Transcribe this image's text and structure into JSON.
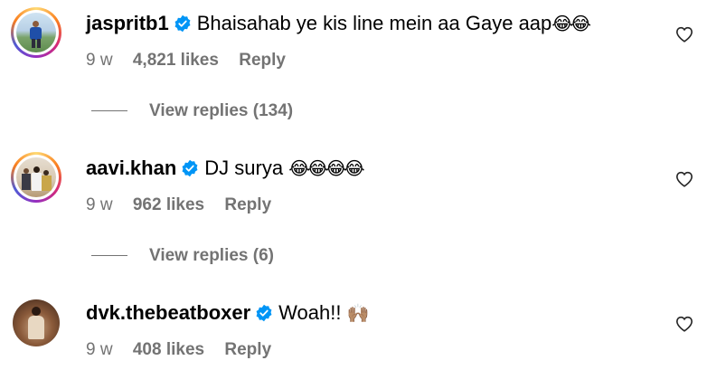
{
  "comments": [
    {
      "username": "jaspritb1",
      "text": "Bhaisahab ye kis line mein aa Gaye aap",
      "emoji": "😂😂",
      "time": "9 w",
      "likes": "4,821 likes",
      "reply_label": "Reply",
      "view_replies": "View replies (134)"
    },
    {
      "username": "aavi.khan",
      "text": "DJ surya",
      "emoji": "😂😂😂😂",
      "time": "9 w",
      "likes": "962 likes",
      "reply_label": "Reply",
      "view_replies": "View replies (6)"
    },
    {
      "username": "dvk.thebeatboxer",
      "text": "Woah!!",
      "emoji": "🙌🏽",
      "time": "9 w",
      "likes": "408 likes",
      "reply_label": "Reply"
    }
  ],
  "icons": {
    "verified": "verified-badge-icon",
    "like": "heart-icon"
  },
  "colors": {
    "verified_blue": "#0095f6",
    "meta_gray": "#737373"
  }
}
